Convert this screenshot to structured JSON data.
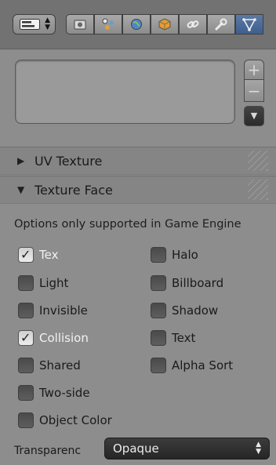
{
  "toolbar": {
    "editor_icon": "properties-editor-icon",
    "context_tabs": [
      {
        "icon": "render-icon",
        "active": false
      },
      {
        "icon": "scene-icon",
        "active": false
      },
      {
        "icon": "world-icon",
        "active": false
      },
      {
        "icon": "object-icon",
        "active": false
      },
      {
        "icon": "constraints-icon",
        "active": false
      },
      {
        "icon": "modifier-wrench-icon",
        "active": false
      },
      {
        "icon": "object-data-mesh-icon",
        "active": true
      }
    ]
  },
  "slot_list": {
    "add_icon": "plus-icon",
    "remove_icon": "minus-icon",
    "menu_icon": "down-arrow-icon",
    "add_glyph": "+",
    "remove_glyph": "−",
    "menu_glyph": "▼"
  },
  "uv_texture": {
    "label": "UV Texture",
    "expanded": false
  },
  "texture_face": {
    "label": "Texture Face",
    "expanded": true,
    "note": "Options only supported in Game Engine",
    "left_options": [
      {
        "label": "Tex",
        "checked": true
      },
      {
        "label": "Light",
        "checked": false
      },
      {
        "label": "Invisible",
        "checked": false
      },
      {
        "label": "Collision",
        "checked": true
      },
      {
        "label": "Shared",
        "checked": false
      },
      {
        "label": "Two-side",
        "checked": false
      },
      {
        "label": "Object Color",
        "checked": false
      }
    ],
    "right_options": [
      {
        "label": "Halo",
        "checked": false
      },
      {
        "label": "Billboard",
        "checked": false
      },
      {
        "label": "Shadow",
        "checked": false
      },
      {
        "label": "Text",
        "checked": false
      },
      {
        "label": "Alpha Sort",
        "checked": false
      }
    ],
    "transparency": {
      "label": "Transparenc",
      "value": "Opaque"
    }
  },
  "colors": {
    "panel_bg": "#8d8d8d",
    "active_tab": "#4a6a96",
    "dropdown_bg": "#2e2e2e"
  }
}
